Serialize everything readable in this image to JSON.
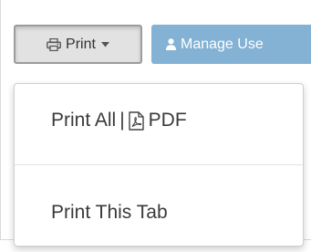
{
  "toolbar": {
    "print_button": {
      "label": "Print",
      "icon": "printer-icon",
      "caret_icon": "caret-down-icon"
    },
    "manage_button": {
      "label": "Manage Use",
      "icon": "user-icon",
      "color": "#84b2d4"
    }
  },
  "print_menu": {
    "items": [
      {
        "label_prefix": "Print All",
        "separator": "|",
        "icon": "file-pdf-icon",
        "label_suffix": "PDF"
      },
      {
        "label": "Print This Tab"
      }
    ]
  }
}
